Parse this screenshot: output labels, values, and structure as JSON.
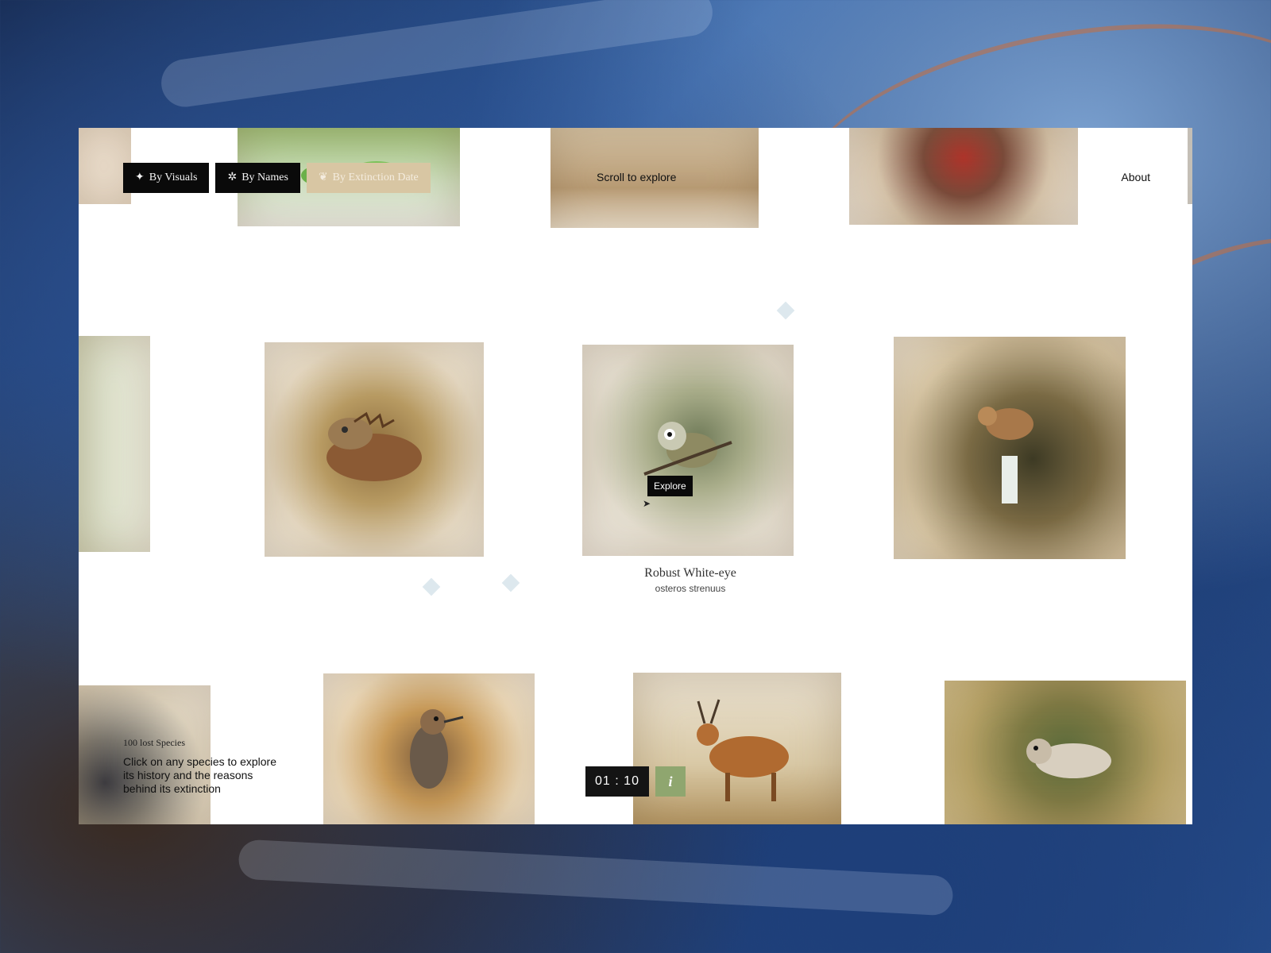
{
  "nav": {
    "by_visuals": "By Visuals",
    "by_names": "By Names",
    "by_extinction_date": "By Extinction Date"
  },
  "header": {
    "scroll_hint": "Scroll to explore",
    "about": "About"
  },
  "focused_species": {
    "tooltip": "Explore",
    "name": "Robust White-eye",
    "latin": "osteros strenuus"
  },
  "info_panel": {
    "title": "100 lost Species",
    "text": "Click on any species to explore its history and the reasons behind its extinction"
  },
  "controls": {
    "timer": "01 : 10",
    "info_label": "i"
  },
  "cards": [
    {
      "subject": "frog"
    },
    {
      "subject": "bird"
    },
    {
      "subject": "flower"
    },
    {
      "subject": "plant"
    },
    {
      "subject": "iguana"
    },
    {
      "subject": "robust-white-eye"
    },
    {
      "subject": "bird-waterfall"
    },
    {
      "subject": "bird"
    },
    {
      "subject": "woodpecker"
    },
    {
      "subject": "deer"
    },
    {
      "subject": "marsupial-mouse"
    }
  ]
}
